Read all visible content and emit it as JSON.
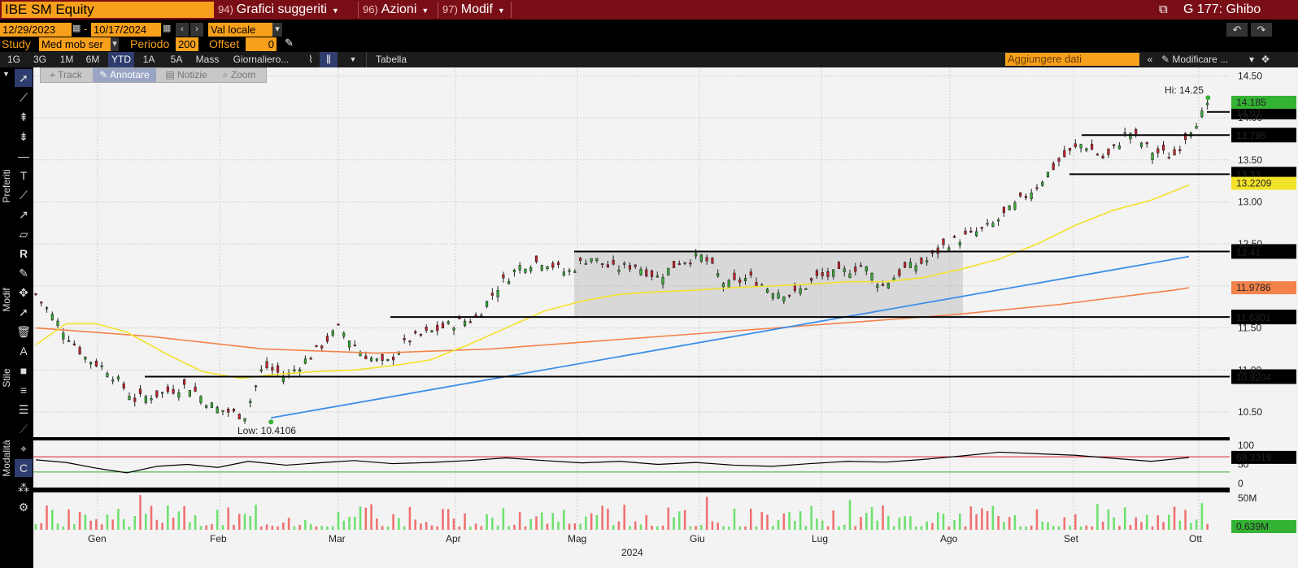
{
  "topbar": {
    "ticker": "IBE SM Equity",
    "menu1_num": "94)",
    "menu1_label": "Grafici suggeriti",
    "menu2_num": "96)",
    "menu2_label": "Azioni",
    "menu3_num": "97)",
    "menu3_label": "Modif",
    "page_label": "G 177: Ghibo"
  },
  "range": {
    "start": "12/29/2023",
    "dash": "-",
    "end": "10/17/2024",
    "currency": "Val locale"
  },
  "study": {
    "label": "Study",
    "value": "Med mob ser",
    "periodo_label": "Periodo",
    "periodo_value": "200",
    "offset_label": "Offset",
    "offset_value": "0"
  },
  "periods": [
    "1G",
    "3G",
    "1M",
    "6M",
    "YTD",
    "1A",
    "5A",
    "Mass",
    "Giornaliero..."
  ],
  "active_period": "YTD",
  "tabella_label": "Tabella",
  "add_data_placeholder": "Aggiungere dati",
  "modify_label": "Modificare ...",
  "annotation_tools": [
    "Track",
    "Annotare",
    "Notizie",
    "Zoom"
  ],
  "side_labels": {
    "preferiti": "Preferiti",
    "modif": "Modif",
    "stile": "Stile",
    "modalita": "Modalità"
  },
  "colors": {
    "up": "#34b233",
    "down": "#d0202a",
    "ma_short": "#f2e22a",
    "ma_long": "#f4824a",
    "trend": "#3c8fe8",
    "accent": "#f7a01c",
    "header": "#7a0e16"
  },
  "chart_data": [
    {
      "type": "candlestick",
      "title": "",
      "x_labels": [
        "Gen",
        "Feb",
        "Mar",
        "Apr",
        "Mag",
        "Giu",
        "Lug",
        "Ago",
        "Set",
        "Ott"
      ],
      "year_label": "2024",
      "ylim": [
        10.2,
        14.6
      ],
      "y_ticks": [
        "14.50",
        "14.00",
        "13.50",
        "13.00",
        "12.50",
        "12.00",
        "11.50",
        "11.00",
        "10.50"
      ],
      "hi_label": "Hi: 14.25",
      "low_label": "Low: 10.4106",
      "hi_value": 14.25,
      "low_value": 10.4106,
      "last_price": "14.185",
      "horizontal_levels": [
        14.07,
        13.795,
        13.33,
        12.41,
        11.6301,
        10.9204
      ],
      "level_labels": [
        "14.07",
        "13.795",
        "13.33",
        "12.41",
        "11.6301",
        "10.9204"
      ],
      "ma_short_label": "13.2209",
      "ma_long_label": "11.9786",
      "close_path": [
        [
          0,
          11.9
        ],
        [
          6,
          11.55
        ],
        [
          13,
          11.15
        ],
        [
          19,
          11.0
        ],
        [
          26,
          10.65
        ],
        [
          33,
          10.72
        ],
        [
          40,
          10.82
        ],
        [
          47,
          10.55
        ],
        [
          55,
          10.45
        ],
        [
          60,
          11.05
        ],
        [
          66,
          10.92
        ],
        [
          72,
          11.15
        ],
        [
          80,
          11.5
        ],
        [
          86,
          11.2
        ],
        [
          92,
          11.05
        ],
        [
          98,
          11.35
        ],
        [
          104,
          11.45
        ],
        [
          110,
          11.55
        ],
        [
          116,
          11.62
        ],
        [
          122,
          12.0
        ],
        [
          128,
          12.25
        ],
        [
          134,
          12.3
        ],
        [
          140,
          12.15
        ],
        [
          146,
          12.35
        ],
        [
          152,
          12.2
        ],
        [
          158,
          12.25
        ],
        [
          164,
          12.1
        ],
        [
          170,
          12.3
        ],
        [
          176,
          12.35
        ],
        [
          182,
          12.0
        ],
        [
          188,
          12.1
        ],
        [
          194,
          11.95
        ],
        [
          200,
          11.9
        ],
        [
          206,
          12.1
        ],
        [
          212,
          12.15
        ],
        [
          218,
          12.25
        ],
        [
          223,
          12.0
        ],
        [
          229,
          12.2
        ],
        [
          235,
          12.3
        ],
        [
          240,
          12.5
        ],
        [
          246,
          12.6
        ],
        [
          252,
          12.72
        ],
        [
          258,
          12.95
        ],
        [
          264,
          13.2
        ],
        [
          270,
          13.5
        ],
        [
          276,
          13.7
        ],
        [
          282,
          13.5
        ],
        [
          288,
          13.85
        ],
        [
          294,
          13.6
        ],
        [
          300,
          13.55
        ],
        [
          304,
          13.85
        ],
        [
          308,
          14.07
        ],
        [
          310,
          14.185
        ]
      ],
      "ma_short_path": [
        [
          0,
          11.3
        ],
        [
          8,
          11.55
        ],
        [
          16,
          11.55
        ],
        [
          24,
          11.45
        ],
        [
          34,
          11.2
        ],
        [
          44,
          10.98
        ],
        [
          54,
          10.9
        ],
        [
          64,
          10.95
        ],
        [
          74,
          10.98
        ],
        [
          84,
          11.0
        ],
        [
          94,
          11.05
        ],
        [
          104,
          11.12
        ],
        [
          114,
          11.3
        ],
        [
          124,
          11.5
        ],
        [
          134,
          11.7
        ],
        [
          144,
          11.82
        ],
        [
          154,
          11.9
        ],
        [
          164,
          11.93
        ],
        [
          174,
          11.95
        ],
        [
          184,
          11.98
        ],
        [
          194,
          12.0
        ],
        [
          204,
          12.02
        ],
        [
          214,
          12.05
        ],
        [
          224,
          12.05
        ],
        [
          234,
          12.1
        ],
        [
          244,
          12.2
        ],
        [
          254,
          12.32
        ],
        [
          264,
          12.5
        ],
        [
          274,
          12.72
        ],
        [
          284,
          12.9
        ],
        [
          294,
          13.02
        ],
        [
          304,
          13.2
        ]
      ],
      "ma_long_path": [
        [
          0,
          11.5
        ],
        [
          30,
          11.4
        ],
        [
          60,
          11.25
        ],
        [
          90,
          11.2
        ],
        [
          120,
          11.25
        ],
        [
          150,
          11.35
        ],
        [
          180,
          11.45
        ],
        [
          210,
          11.55
        ],
        [
          240,
          11.65
        ],
        [
          270,
          11.78
        ],
        [
          300,
          11.95
        ],
        [
          304,
          11.9786
        ]
      ],
      "trend_path": [
        [
          62,
          10.43
        ],
        [
          304,
          12.35
        ]
      ],
      "rsi": {
        "value_label": "68.3319",
        "ticks": [
          "100",
          "50",
          "0"
        ],
        "upper": 70,
        "lower": 30,
        "path": [
          [
            0,
            62
          ],
          [
            8,
            55
          ],
          [
            16,
            40
          ],
          [
            24,
            28
          ],
          [
            32,
            45
          ],
          [
            40,
            50
          ],
          [
            48,
            42
          ],
          [
            56,
            58
          ],
          [
            66,
            48
          ],
          [
            76,
            55
          ],
          [
            84,
            60
          ],
          [
            94,
            52
          ],
          [
            104,
            55
          ],
          [
            114,
            60
          ],
          [
            124,
            67
          ],
          [
            134,
            60
          ],
          [
            144,
            54
          ],
          [
            154,
            58
          ],
          [
            164,
            50
          ],
          [
            174,
            55
          ],
          [
            184,
            48
          ],
          [
            194,
            45
          ],
          [
            204,
            52
          ],
          [
            214,
            58
          ],
          [
            224,
            56
          ],
          [
            234,
            63
          ],
          [
            244,
            72
          ],
          [
            254,
            82
          ],
          [
            264,
            78
          ],
          [
            274,
            74
          ],
          [
            284,
            66
          ],
          [
            294,
            58
          ],
          [
            304,
            68
          ]
        ]
      },
      "volume": {
        "top_tick": "50M",
        "last_label": "0.639M"
      }
    }
  ]
}
